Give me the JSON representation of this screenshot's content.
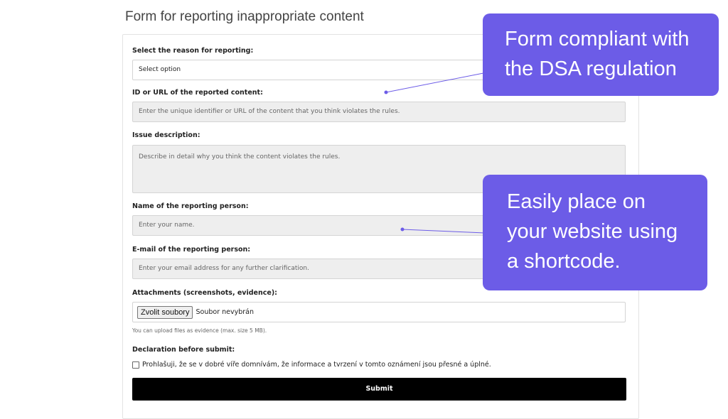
{
  "page": {
    "title": "Form for reporting inappropriate content"
  },
  "form": {
    "reason": {
      "label": "Select the reason for reporting:",
      "value": "Select option"
    },
    "content_id": {
      "label": "ID or URL of the reported content:",
      "placeholder": "Enter the unique identifier or URL of the content that you think violates the rules."
    },
    "description": {
      "label": "Issue description:",
      "placeholder": "Describe in detail why you think the content violates the rules."
    },
    "reporter_name": {
      "label": "Name of the reporting person:",
      "placeholder": "Enter your name."
    },
    "reporter_email": {
      "label": "E-mail of the reporting person:",
      "placeholder": "Enter your email address for any further clarification."
    },
    "attachments": {
      "label": "Attachments (screenshots, evidence):",
      "button_label": "Zvolit soubory",
      "status": "Soubor nevybrán",
      "hint": "You can upload files as evidence (max. size 5 MB)."
    },
    "declaration": {
      "label": "Declaration before submit:",
      "checkbox_text": "Prohlašuji, že se v dobré víře domnívám, že informace a tvrzení v tomto oznámení jsou přesné a úplné."
    },
    "submit_label": "Submit"
  },
  "callouts": [
    {
      "lines": [
        "Form compliant with",
        "the DSA regulation"
      ]
    },
    {
      "lines": [
        "Easily place on",
        "your website using",
        "a shortcode."
      ]
    }
  ],
  "colors": {
    "callout_bg": "#6c5ce7",
    "submit_bg": "#000000",
    "field_bg": "#eeeeee"
  }
}
